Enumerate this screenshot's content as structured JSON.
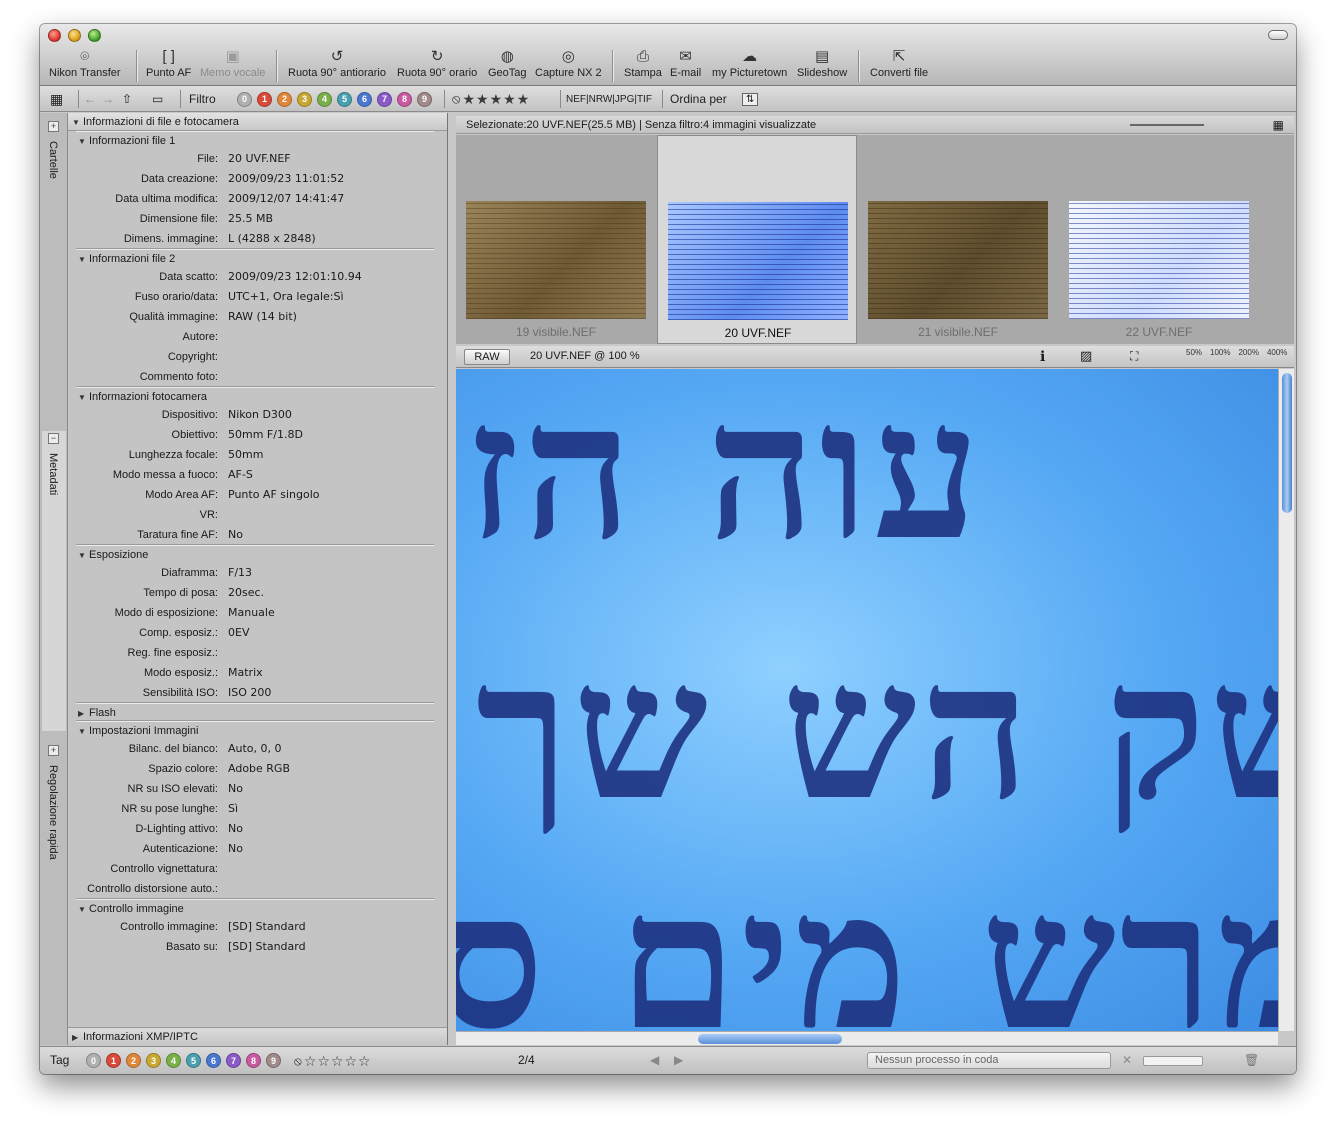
{
  "toolbar": {
    "buttons": [
      {
        "label": "Nikon Transfer",
        "icon": "camera-icon"
      },
      {
        "label": "Punto AF",
        "icon": "focus-point-icon"
      },
      {
        "label": "Memo vocale",
        "icon": "voice-memo-icon"
      },
      {
        "label": "Ruota 90° antiorario",
        "icon": "rotate-left-icon"
      },
      {
        "label": "Ruota 90° orario",
        "icon": "rotate-right-icon"
      },
      {
        "label": "GeoTag",
        "icon": "globe-icon"
      },
      {
        "label": "Capture NX 2",
        "icon": "capture-nx-icon"
      },
      {
        "label": "Stampa",
        "icon": "printer-icon"
      },
      {
        "label": "E-mail",
        "icon": "envelope-icon"
      },
      {
        "label": "my Picturetown",
        "icon": "cloud-icon"
      },
      {
        "label": "Slideshow",
        "icon": "slideshow-icon"
      },
      {
        "label": "Converti file",
        "icon": "convert-icon"
      }
    ]
  },
  "filterbar": {
    "filter_label": "Filtro",
    "labels": [
      "0",
      "1",
      "2",
      "3",
      "4",
      "5",
      "6",
      "7",
      "8",
      "9"
    ],
    "label_colors": [
      "#b0b0b0",
      "#d94a3a",
      "#e0873a",
      "#c8a830",
      "#7ab04a",
      "#4aa0b0",
      "#4a78d0",
      "#8a5ac8",
      "#c85aa0",
      "#a08a8a"
    ],
    "stars": "★★★★★",
    "formats": "NEF|NRW|JPG|TIF",
    "sort_label": "Ordina per"
  },
  "sidetabs": {
    "folders": "Cartelle",
    "metadata": "Metadati",
    "quick": "Regolazione rapida"
  },
  "meta": {
    "header": "Informazioni di file e fotocamera",
    "groups": [
      {
        "title": "Informazioni file 1",
        "rows": [
          {
            "k": "File:",
            "v": "20 UVF.NEF"
          },
          {
            "k": "Data creazione:",
            "v": "2009/09/23 11:01:52"
          },
          {
            "k": "Data ultima modifica:",
            "v": "2009/12/07 14:41:47"
          },
          {
            "k": "Dimensione file:",
            "v": "25.5 MB"
          },
          {
            "k": "Dimens. immagine:",
            "v": "L (4288 x 2848)"
          }
        ]
      },
      {
        "title": "Informazioni file 2",
        "rows": [
          {
            "k": "Data scatto:",
            "v": "2009/09/23 12:01:10.94"
          },
          {
            "k": "Fuso orario/data:",
            "v": "UTC+1, Ora legale:Sì"
          },
          {
            "k": "Qualità immagine:",
            "v": "RAW (14 bit)"
          },
          {
            "k": "Autore:",
            "v": ""
          },
          {
            "k": "Copyright:",
            "v": ""
          },
          {
            "k": "Commento foto:",
            "v": ""
          }
        ]
      },
      {
        "title": "Informazioni fotocamera",
        "rows": [
          {
            "k": "Dispositivo:",
            "v": "Nikon D300"
          },
          {
            "k": "Obiettivo:",
            "v": "50mm F/1.8D"
          },
          {
            "k": "Lunghezza focale:",
            "v": "50mm"
          },
          {
            "k": "Modo messa a fuoco:",
            "v": "AF-S"
          },
          {
            "k": "Modo Area AF:",
            "v": "Punto AF singolo"
          },
          {
            "k": "VR:",
            "v": ""
          },
          {
            "k": "Taratura fine AF:",
            "v": "No"
          }
        ]
      },
      {
        "title": "Esposizione",
        "rows": [
          {
            "k": "Diaframma:",
            "v": "F/13"
          },
          {
            "k": "Tempo di posa:",
            "v": "20sec."
          },
          {
            "k": "Modo di esposizione:",
            "v": "Manuale"
          },
          {
            "k": "Comp. esposiz.:",
            "v": "0EV"
          },
          {
            "k": "Reg. fine esposiz.:",
            "v": ""
          },
          {
            "k": "Modo esposiz.:",
            "v": "Matrix"
          },
          {
            "k": "Sensibilità ISO:",
            "v": "ISO 200"
          }
        ]
      },
      {
        "title": "Flash",
        "collapsed": true,
        "rows": []
      },
      {
        "title": "Impostazioni Immagini",
        "rows": [
          {
            "k": "Bilanc. del bianco:",
            "v": "Auto, 0, 0"
          },
          {
            "k": "Spazio colore:",
            "v": "Adobe RGB"
          },
          {
            "k": "NR su ISO elevati:",
            "v": "No"
          },
          {
            "k": "NR su pose lunghe:",
            "v": "Sì"
          },
          {
            "k": "D-Lighting attivo:",
            "v": "No"
          },
          {
            "k": "Autenticazione:",
            "v": "No"
          },
          {
            "k": "Controllo vignettatura:",
            "v": ""
          },
          {
            "k": "Controllo distorsione auto.:",
            "v": ""
          }
        ]
      },
      {
        "title": "Controllo immagine",
        "rows": [
          {
            "k": "Controllo immagine:",
            "v": "[SD] Standard"
          },
          {
            "k": "Basato su:",
            "v": "[SD] Standard"
          }
        ]
      }
    ],
    "footer": "Informazioni XMP/IPTC"
  },
  "selection": {
    "text": "Selezionate:20 UVF.NEF(25.5 MB) | Senza filtro:4 immagini visualizzate"
  },
  "thumbnails": [
    {
      "name": "19 visibile.NEF",
      "style": "img-brown",
      "selected": false
    },
    {
      "name": "20 UVF.NEF",
      "style": "img-blue",
      "selected": true
    },
    {
      "name": "21 visibile.NEF",
      "style": "img-brown2",
      "selected": false
    },
    {
      "name": "22 UVF.NEF",
      "style": "img-bluew",
      "selected": false
    }
  ],
  "viewer": {
    "raw": "RAW",
    "name": "20 UVF.NEF @ 100 %",
    "zooms": [
      "50%",
      "100%",
      "200%",
      "400%"
    ],
    "hebrew": [
      "עוה הז",
      "שק הש שך",
      "מרש מים ס"
    ]
  },
  "status": {
    "tag_label": "Tag",
    "stars": "☆☆☆☆☆",
    "counter": "2/4",
    "queue": "Nessun processo in coda"
  }
}
